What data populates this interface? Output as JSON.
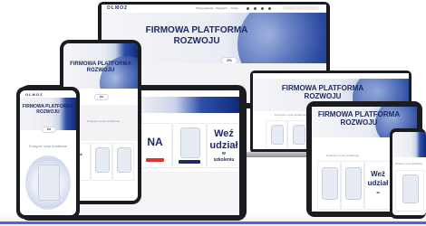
{
  "brand": {
    "logo": "OLMOZ",
    "logo_desktop": "OLMOZ"
  },
  "hero": {
    "title_line1": "FIRMOWA PLATFORMA",
    "title_line2": "ROZWOJU"
  },
  "pill": {
    "label": "2%"
  },
  "section": {
    "available_courses": "Dostępne opcje dodatkowe"
  },
  "desktop_nav": [
    "Strona główna",
    "Kategorie",
    "Kursy"
  ],
  "cards": {
    "na": "NA",
    "wez": "Weź",
    "udzial": "udział",
    "w": "w",
    "szkoleniu": "szkoleniu"
  },
  "colors": {
    "navy": "#1d2a66",
    "blue_silk": "#2f4fa8",
    "accent_line": "#5b5fd6",
    "red": "#e0322e"
  }
}
